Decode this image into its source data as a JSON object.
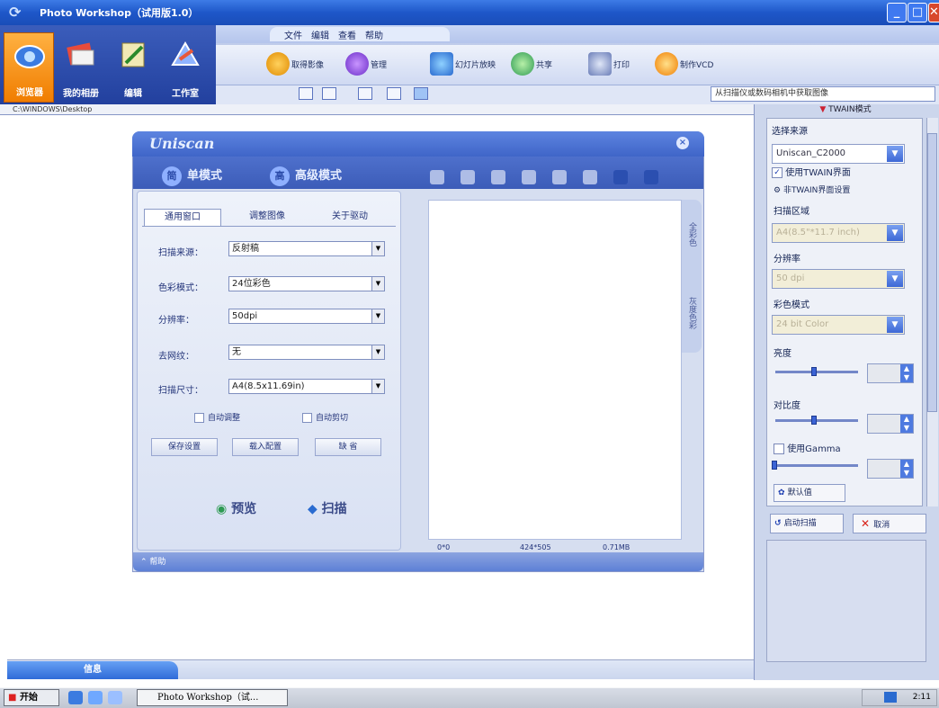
{
  "window": {
    "title": "Photo Workshop（试用版1.0）"
  },
  "main_nav": [
    {
      "label": "浏览器"
    },
    {
      "label": "我的相册"
    },
    {
      "label": "编辑"
    },
    {
      "label": "工作室"
    }
  ],
  "menu": [
    "文件",
    "编辑",
    "查看",
    "帮助"
  ],
  "tools": [
    {
      "label": "取得影像"
    },
    {
      "label": "管理"
    },
    {
      "label": "幻灯片放映"
    },
    {
      "label": "共享"
    },
    {
      "label": "打印"
    },
    {
      "label": "制作VCD"
    }
  ],
  "search": {
    "text": "从扫描仪或数码相机中获取图像"
  },
  "path": {
    "current": "C:\\WINDOWS\\Desktop"
  },
  "scanner": {
    "brand": "Uniscan",
    "modes": [
      "单模式",
      "高级模式"
    ],
    "mode_badges": [
      "简",
      "高"
    ],
    "tabs": [
      "通用窗口",
      "调整图像",
      "关于驱动"
    ],
    "fields": [
      {
        "label": "扫描来源：",
        "value": "反射稿"
      },
      {
        "label": "色彩模式：",
        "value": "24位彩色"
      },
      {
        "label": "分辨率：",
        "value": "50dpi"
      },
      {
        "label": "去网纹：",
        "value": "无"
      },
      {
        "label": "扫描尺寸：",
        "value": "A4(8.5x11.69in)"
      }
    ],
    "auto_adjust": "自动调整",
    "auto_crop": "自动剪切",
    "buttons": [
      "保存设置",
      "载入配置",
      "缺 省"
    ],
    "preview": "预览",
    "scan": "扫描",
    "side_tabs": [
      "全彩色",
      "灰度色彩"
    ],
    "status": {
      "pos": "0*0",
      "size": "424*505",
      "mem": "0.71MB"
    },
    "help": "帮助"
  },
  "twain": {
    "header": "TWAIN模式",
    "source_label": "选择来源",
    "source_value": "Uniscan_C2000",
    "use_twain_ui": "使用TWAIN界面",
    "non_twain_settings": "非TWAIN界面设置",
    "scan_area_label": "扫描区域",
    "scan_area_value": "A4(8.5\"*11.7 inch)",
    "resolution_label": "分辨率",
    "resolution_value": "50 dpi",
    "color_mode_label": "彩色模式",
    "color_mode_value": "24 bit Color",
    "brightness_label": "亮度",
    "contrast_label": "对比度",
    "use_gamma": "使用Gamma",
    "defaults_button": "默认值",
    "start_button": "启动扫描",
    "cancel_button": "取消"
  },
  "bottom": {
    "info_tab": "信息"
  },
  "taskbar": {
    "start": "开始",
    "task": "Photo Workshop（试...",
    "clock": "2:11"
  }
}
